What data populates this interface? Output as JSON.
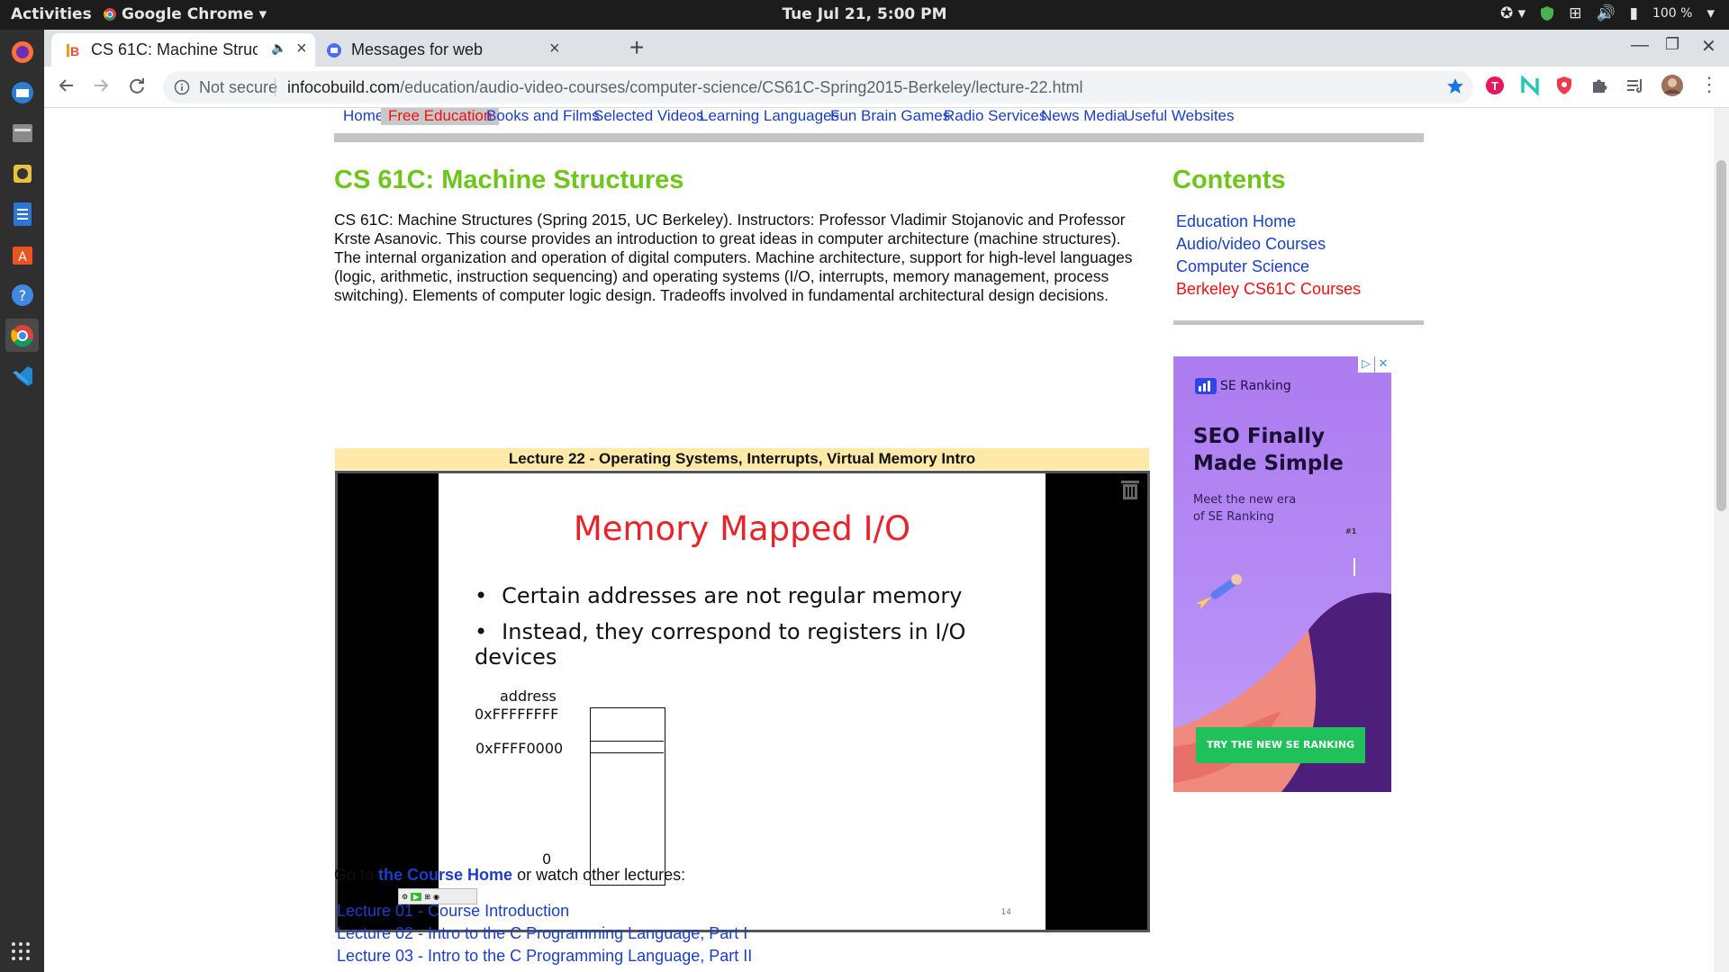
{
  "system": {
    "activities": "Activities",
    "app_name": "Google Chrome",
    "clock": "Tue Jul 21,  5:00 PM",
    "battery": "100 %"
  },
  "browser": {
    "tabs": [
      {
        "label": "CS 61C: Machine Struc"
      },
      {
        "label": "Messages for web"
      }
    ],
    "security": "Not secure",
    "url_domain": "infocobuild.com",
    "url_path": "/education/audio-video-courses/computer-science/CS61C-Spring2015-Berkeley/lecture-22.html"
  },
  "site": {
    "nav": [
      "Home",
      "Free Education",
      "Books and Films",
      "Selected Videos",
      "Learning Languages",
      "Fun Brain Games",
      "Radio Services",
      "News Media",
      "Useful Websites"
    ],
    "title": "CS 61C: Machine Structures",
    "description": "CS 61C: Machine Structures (Spring 2015, UC Berkeley). Instructors: Professor Vladimir Stojanovic and Professor Krste Asanovic. This course provides an introduction to great ideas in computer architecture (machine structures). The internal organization and operation of digital computers. Machine architecture, support for high-level languages (logic, arithmetic, instruction sequencing) and operating systems (I/O, interrupts, memory management, process switching). Elements of computer logic design. Tradeoffs involved in fundamental architectural design decisions.",
    "lecture_title": "Lecture 22 - Operating Systems, Interrupts, Virtual Memory Intro",
    "slide": {
      "title": "Memory Mapped I/O",
      "bullets": [
        "Certain addresses are not regular memory",
        "Instead, they correspond to registers in I/O devices"
      ],
      "address_label": "address",
      "addr_top": "0xFFFFFFFF",
      "addr_mid": "0xFFFF0000",
      "addr_zero": "0",
      "page_number": "14"
    },
    "goto_prefix": "Go to ",
    "goto_link": "the Course Home",
    "goto_suffix": " or watch other lectures:",
    "lectures": [
      "Lecture 01 - Course Introduction",
      "Lecture 02 - Intro to the C Programming Language, Part I",
      "Lecture 03 - Intro to the C Programming Language, Part II"
    ],
    "contents_title": "Contents",
    "contents_links": [
      "Education Home",
      "Audio/video Courses",
      "Computer Science",
      "Berkeley CS61C Courses"
    ]
  },
  "ad": {
    "brand": "SE Ranking",
    "headline_1": "SEO Finally",
    "headline_2": "Made Simple",
    "sub_1": "Meet the new era",
    "sub_2": "of SE Ranking",
    "flag": "#1",
    "cta": "TRY THE NEW SE RANKING"
  },
  "colors": {
    "nav_link": "#1a3fc7",
    "title_green": "#6ec51c",
    "active_red": "#e11",
    "lecture_bar": "#ffe9a8",
    "slide_title": "#e6242b"
  }
}
